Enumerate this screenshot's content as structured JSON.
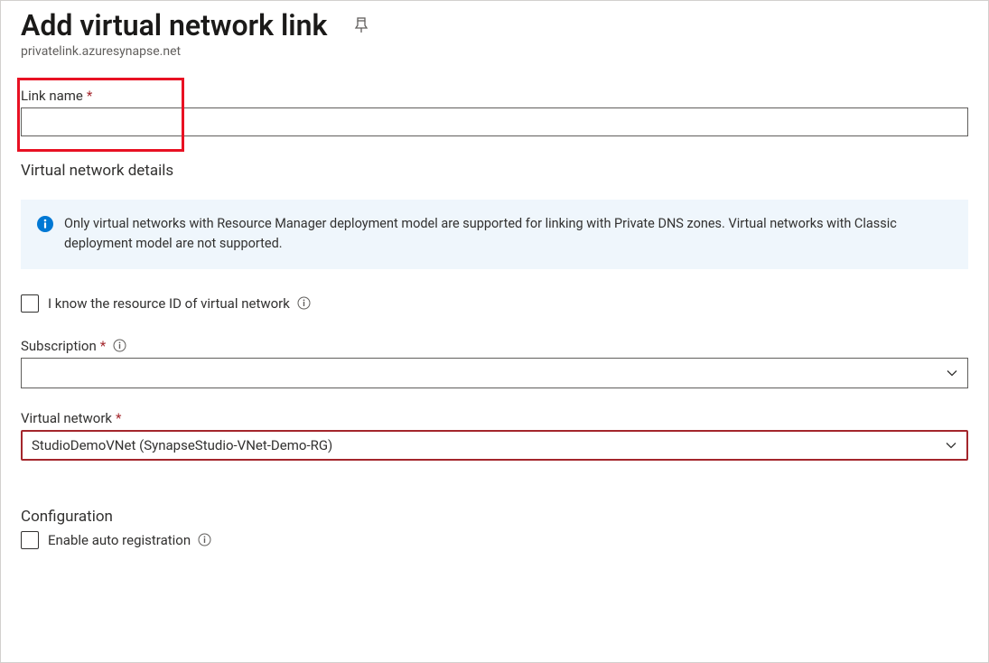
{
  "header": {
    "title": "Add virtual network link",
    "breadcrumb": "privatelink.azuresynapse.net"
  },
  "fields": {
    "link_name": {
      "label": "Link name",
      "value": ""
    },
    "vnet_details_heading": "Virtual network details",
    "info_box": "Only virtual networks with Resource Manager deployment model are supported for linking with Private DNS zones. Virtual networks with Classic deployment model are not supported.",
    "know_resource_id": {
      "label": "I know the resource ID of virtual network",
      "checked": false
    },
    "subscription": {
      "label": "Subscription",
      "value": ""
    },
    "virtual_network": {
      "label": "Virtual network",
      "value": "StudioDemoVNet (SynapseStudio-VNet-Demo-RG)"
    },
    "configuration_heading": "Configuration",
    "enable_auto_registration": {
      "label": "Enable auto registration",
      "checked": false
    }
  }
}
